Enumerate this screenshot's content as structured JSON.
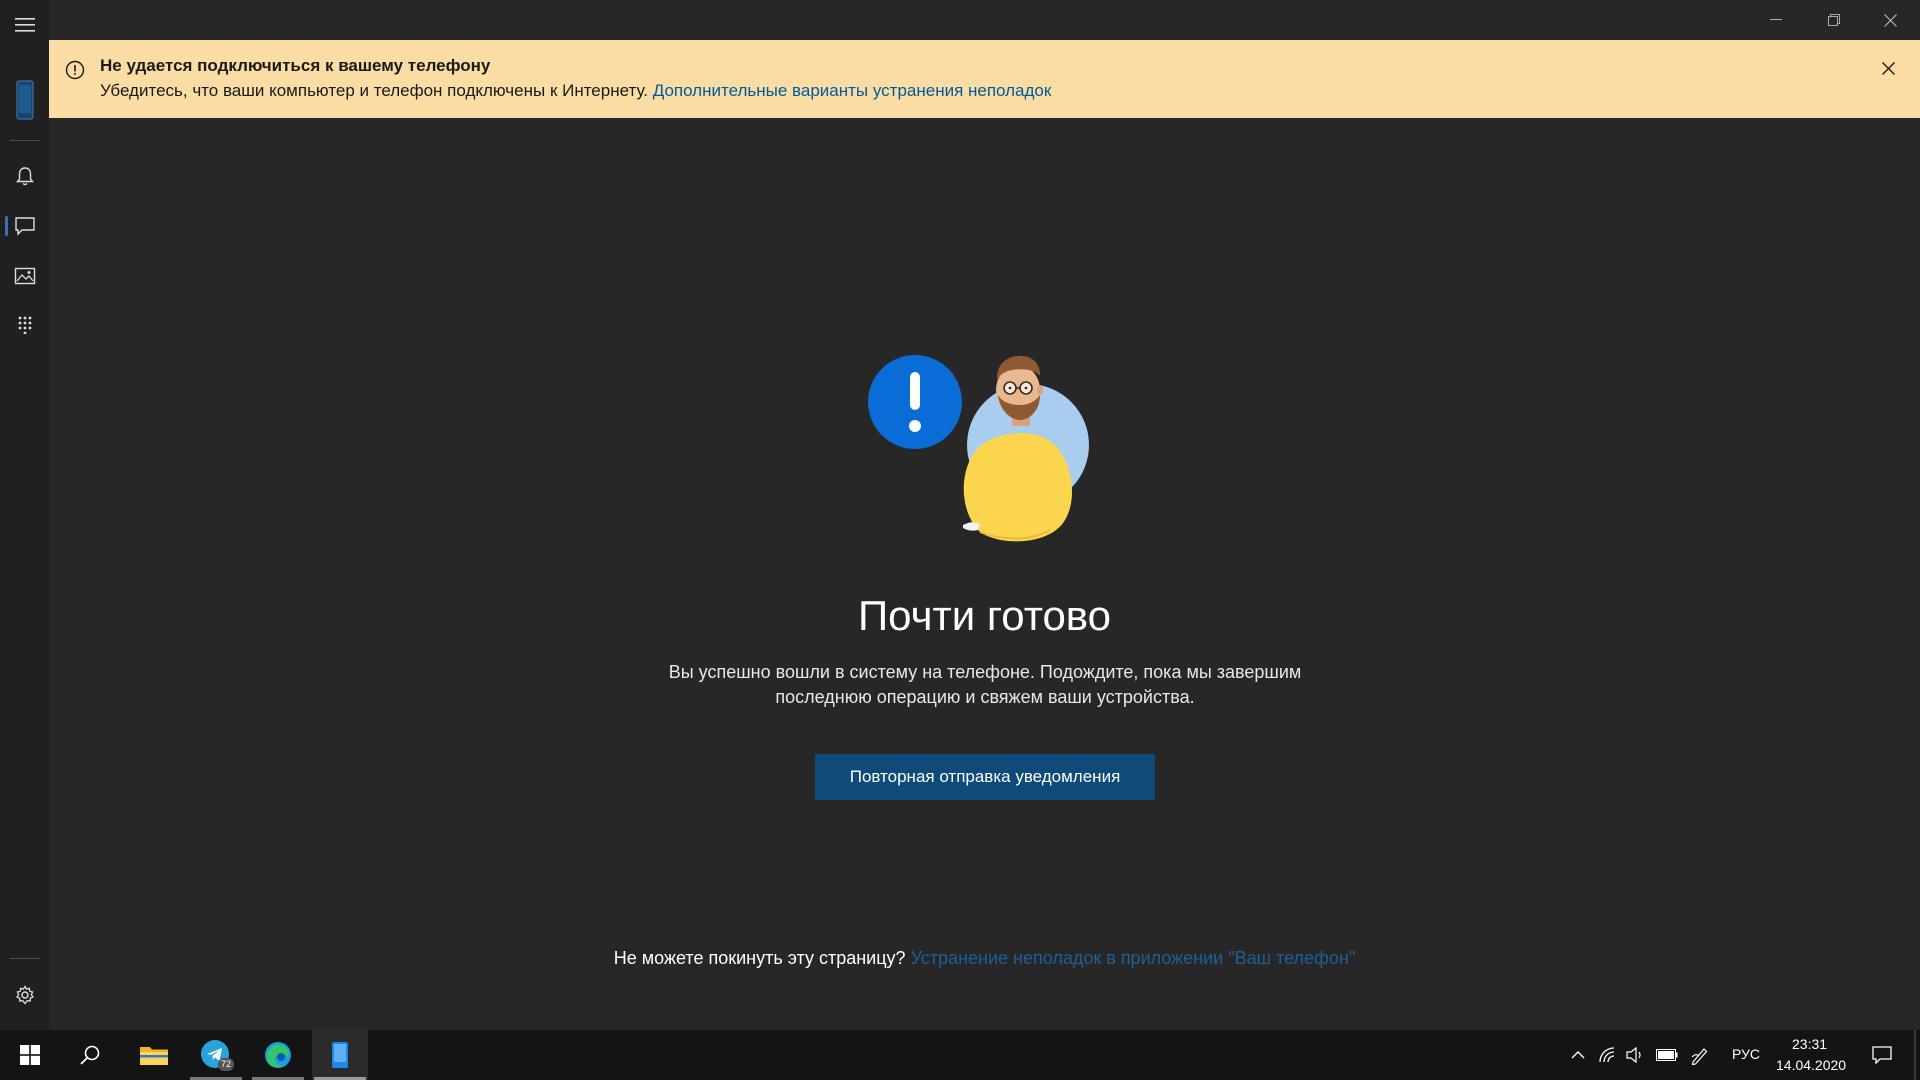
{
  "window": {
    "controls": {
      "minimize": "—",
      "restore": "❐",
      "close": "✕"
    }
  },
  "sidebar": {
    "items": [
      {
        "name": "menu",
        "icon": "hamburger-icon"
      },
      {
        "name": "phone",
        "icon": "phone-icon"
      },
      {
        "name": "notifications",
        "icon": "bell-icon"
      },
      {
        "name": "messages",
        "icon": "message-icon"
      },
      {
        "name": "photos",
        "icon": "photos-icon"
      },
      {
        "name": "apps",
        "icon": "dialpad-icon"
      },
      {
        "name": "settings",
        "icon": "gear-icon"
      }
    ]
  },
  "banner": {
    "title": "Не удается подключиться к вашему телефону",
    "text": "Убедитесь, что ваши компьютер и телефон подключены к Интернету.",
    "link": "Дополнительные варианты устранения неполадок"
  },
  "main": {
    "heading": "Почти готово",
    "description": "Вы успешно вошли в систему на телефоне. Подождите, пока мы завершим последнюю операцию и свяжем ваши устройства.",
    "button": "Повторная отправка уведомления",
    "footer_text": "Не можете покинуть эту страницу?",
    "footer_link": "Устранение неполадок в приложении \"Ваш телефон\""
  },
  "taskbar": {
    "telegram_badge": "72",
    "language": "РУС",
    "time": "23:31",
    "date": "14.04.2020"
  },
  "colors": {
    "background": "#272727",
    "banner": "#f9dda4",
    "accent_button": "#0e4a7a",
    "link_banner": "#005a9e",
    "link_footer": "#1d5f96"
  }
}
